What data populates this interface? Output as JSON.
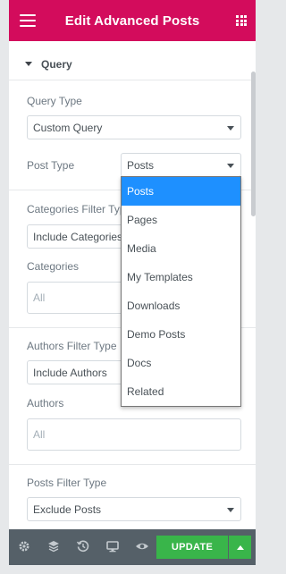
{
  "header": {
    "title": "Edit Advanced Posts"
  },
  "section": {
    "title": "Query"
  },
  "fields": {
    "query_type_label": "Query Type",
    "query_type_value": "Custom Query",
    "post_type_label": "Post Type",
    "post_type_value": "Posts",
    "categories_filter_label": "Categories Filter Type",
    "categories_filter_value": "Include Categories",
    "categories_label": "Categories",
    "categories_placeholder": "All",
    "authors_filter_label": "Authors Filter Type",
    "authors_filter_value": "Include Authors",
    "authors_label": "Authors",
    "authors_placeholder": "All",
    "posts_filter_label": "Posts Filter Type",
    "posts_filter_value": "Exclude Posts"
  },
  "dropdown": {
    "options": [
      "Posts",
      "Pages",
      "Media",
      "My Templates",
      "Downloads",
      "Demo Posts",
      "Docs",
      "Related"
    ],
    "selected": "Posts"
  },
  "footer": {
    "icons": [
      "settings-icon",
      "layers-icon",
      "history-icon",
      "responsive-icon",
      "preview-icon"
    ],
    "update_label": "UPDATE"
  },
  "colors": {
    "header": "#d30c5c",
    "footer": "#556068",
    "update": "#39b54a",
    "selected_option": "#1e90ff"
  }
}
